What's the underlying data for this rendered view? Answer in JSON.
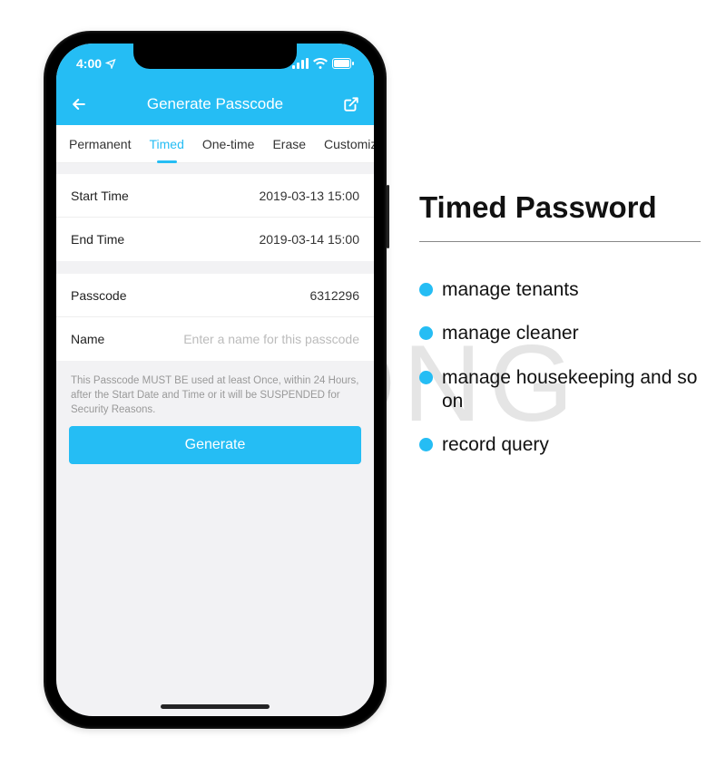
{
  "watermark": "AHONG",
  "statusbar": {
    "time": "4:00"
  },
  "nav": {
    "title": "Generate Passcode"
  },
  "tabs": [
    "Permanent",
    "Timed",
    "One-time",
    "Erase",
    "Customize"
  ],
  "activeTabIndex": 1,
  "fields": {
    "startTime": {
      "label": "Start Time",
      "value": "2019-03-13 15:00"
    },
    "endTime": {
      "label": "End Time",
      "value": "2019-03-14 15:00"
    },
    "passcode": {
      "label": "Passcode",
      "value": "6312296"
    },
    "name": {
      "label": "Name",
      "placeholder": "Enter a name for this passcode"
    }
  },
  "note": "This Passcode MUST BE used at least Once, within 24 Hours, after the Start Date and Time or it will be SUSPENDED for Security Reasons.",
  "generateLabel": "Generate",
  "side": {
    "title": "Timed Password",
    "bullets": [
      "manage tenants",
      "manage cleaner",
      "manage housekeeping and so on",
      "record query"
    ]
  },
  "colors": {
    "accent": "#25bdf4"
  }
}
